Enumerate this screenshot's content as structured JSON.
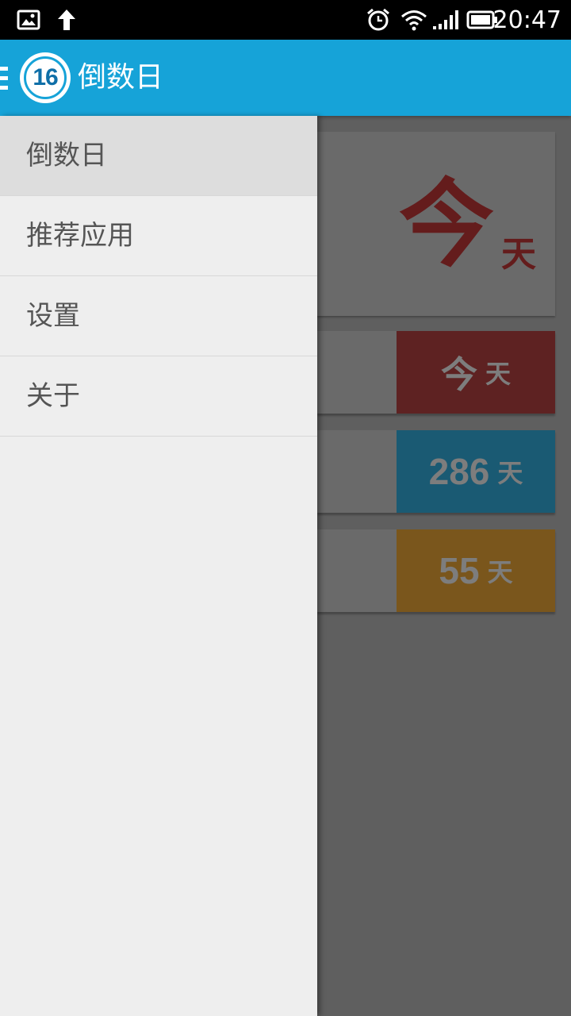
{
  "status_bar": {
    "time": "20:47",
    "left_icons": [
      "image-icon",
      "upload-arrow-icon"
    ],
    "right_icons": [
      "alarm-icon",
      "wifi-icon",
      "signal-icon",
      "battery-icon"
    ]
  },
  "app_bar": {
    "logo_number": "16",
    "title": "倒数日",
    "color": "#16a3d8"
  },
  "drawer": {
    "items": [
      {
        "label": "倒数日",
        "active": true
      },
      {
        "label": "推荐应用",
        "active": false
      },
      {
        "label": "设置",
        "active": false
      },
      {
        "label": "关于",
        "active": false
      }
    ]
  },
  "background": {
    "hero": {
      "big": "今",
      "unit": "天"
    },
    "events": [
      {
        "value": "今",
        "unit": "天",
        "color": "#5e2222"
      },
      {
        "value": "286",
        "unit": "天",
        "color": "#1a5a73"
      },
      {
        "value": "55",
        "unit": "天",
        "color": "#7a561c"
      }
    ]
  }
}
